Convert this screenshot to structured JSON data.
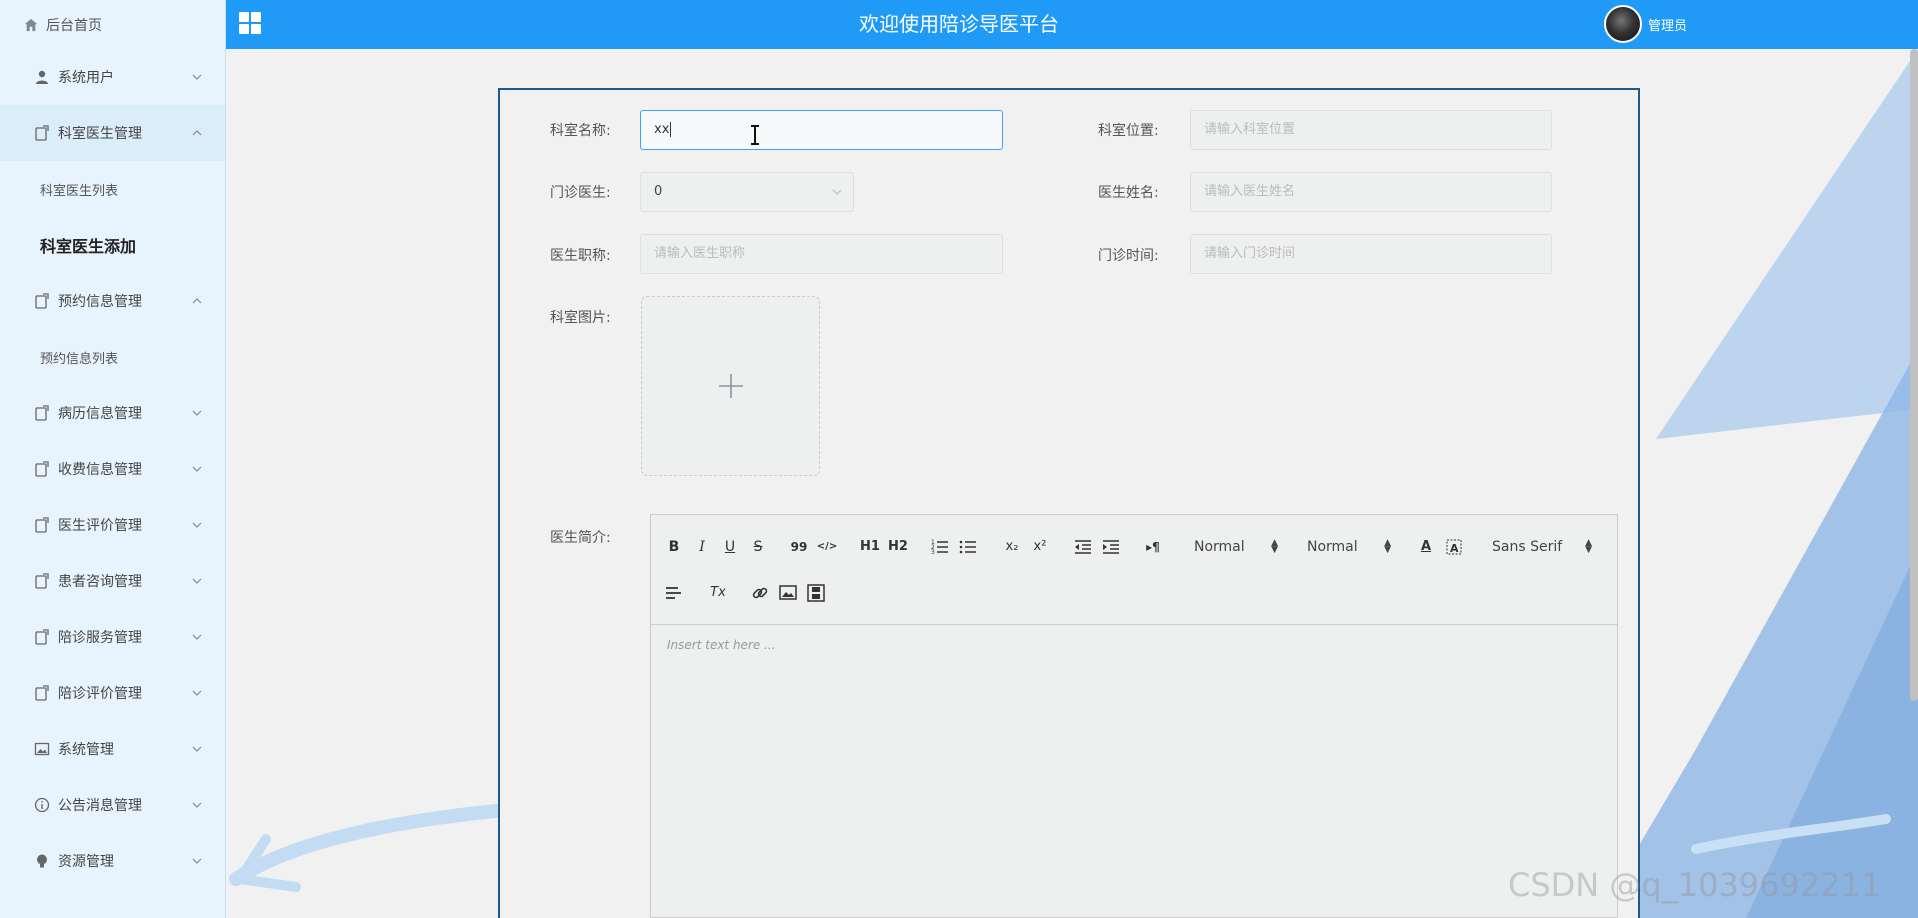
{
  "header": {
    "home_label": "后台首页",
    "title": "欢迎使用陪诊导医平台",
    "user_name": "管理员",
    "brand_color": "#1f9bf7"
  },
  "sidebar": {
    "items": [
      {
        "label": "系统用户",
        "icon": "user-icon",
        "expanded": false
      },
      {
        "label": "科室医生管理",
        "icon": "clipboard-icon",
        "expanded": true,
        "children": [
          "科室医生列表",
          "科室医生添加"
        ],
        "active_child": "科室医生添加"
      },
      {
        "label": "预约信息管理",
        "icon": "clipboard-icon",
        "expanded": true,
        "children": [
          "预约信息列表"
        ]
      },
      {
        "label": "病历信息管理",
        "icon": "clipboard-icon",
        "expanded": false
      },
      {
        "label": "收费信息管理",
        "icon": "clipboard-icon",
        "expanded": false
      },
      {
        "label": "医生评价管理",
        "icon": "clipboard-icon",
        "expanded": false
      },
      {
        "label": "患者咨询管理",
        "icon": "clipboard-icon",
        "expanded": false
      },
      {
        "label": "陪诊服务管理",
        "icon": "clipboard-icon",
        "expanded": false
      },
      {
        "label": "陪诊评价管理",
        "icon": "clipboard-icon",
        "expanded": false
      },
      {
        "label": "系统管理",
        "icon": "image-icon",
        "expanded": false
      },
      {
        "label": "公告消息管理",
        "icon": "info-icon",
        "expanded": false
      },
      {
        "label": "资源管理",
        "icon": "bulb-icon",
        "expanded": false
      }
    ]
  },
  "form": {
    "dept_name": {
      "label": "科室名称:",
      "value": "xx"
    },
    "dept_location": {
      "label": "科室位置:",
      "placeholder": "请输入科室位置"
    },
    "clinic_doctor": {
      "label": "门诊医生:",
      "value": "0"
    },
    "doctor_name": {
      "label": "医生姓名:",
      "placeholder": "请输入医生姓名"
    },
    "doctor_title": {
      "label": "医生职称:",
      "placeholder": "请输入医生职称"
    },
    "clinic_time": {
      "label": "门诊时间:",
      "placeholder": "请输入门诊时间"
    },
    "dept_image": {
      "label": "科室图片:"
    },
    "doctor_intro": {
      "label": "医生简介:"
    }
  },
  "editor": {
    "toolbar": {
      "bold": "B",
      "italic": "I",
      "underline": "U",
      "strike": "S",
      "blockquote": "99",
      "code": "</>",
      "h1": "H1",
      "h2": "H2",
      "sub": "x₂",
      "sup": "x²",
      "rtl": "▸¶",
      "size_select": "Normal",
      "header_select": "Normal",
      "font_select": "Sans Serif",
      "color": "A",
      "clean": "Tx"
    },
    "placeholder": "Insert text here ..."
  },
  "watermark": "CSDN @q_1039692211"
}
